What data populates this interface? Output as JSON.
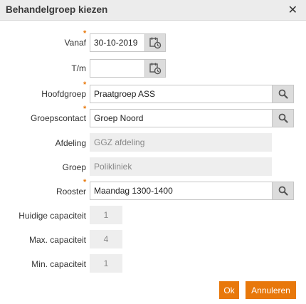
{
  "dialog": {
    "title": "Behandelgroep kiezen",
    "close_symbol": "✕"
  },
  "fields": {
    "vanaf": {
      "label": "Vanaf",
      "required_mark": "*",
      "value": "30-10-2019",
      "icon": "calendar-clock-icon"
    },
    "tm": {
      "label": "T/m",
      "value": "",
      "icon": "calendar-clock-icon"
    },
    "hoofdgroep": {
      "label": "Hoofdgroep",
      "required_mark": "*",
      "value": "Praatgroep ASS",
      "icon": "search-icon"
    },
    "groepscontact": {
      "label": "Groepscontact",
      "required_mark": "*",
      "value": "Groep Noord",
      "icon": "search-icon"
    },
    "afdeling": {
      "label": "Afdeling",
      "value": "GGZ afdeling"
    },
    "groep": {
      "label": "Groep",
      "value": "Polikliniek"
    },
    "rooster": {
      "label": "Rooster",
      "required_mark": "*",
      "value": "Maandag 1300-1400",
      "icon": "search-icon"
    },
    "huidige_capaciteit": {
      "label": "Huidige capaciteit",
      "value": "1"
    },
    "max_capaciteit": {
      "label": "Max. capaciteit",
      "value": "4"
    },
    "min_capaciteit": {
      "label": "Min. capaciteit",
      "value": "1"
    }
  },
  "buttons": {
    "ok": "Ok",
    "cancel": "Annuleren"
  },
  "colors": {
    "accent": "#e8780b",
    "titlebar": "#ececec",
    "readonly": "#eeeeee",
    "addon": "#dcdcdc"
  }
}
